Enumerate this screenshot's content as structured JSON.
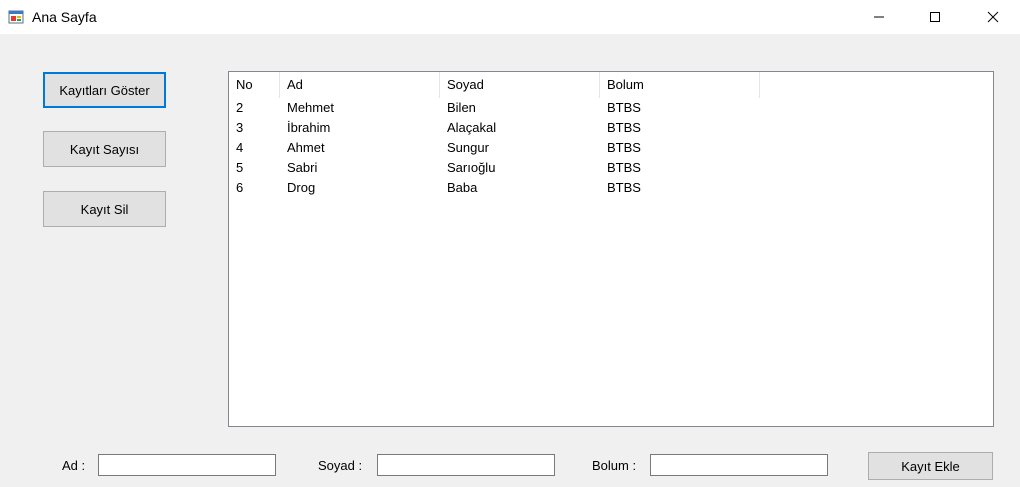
{
  "window": {
    "title": "Ana Sayfa",
    "app_icon": "form-app-icon",
    "controls": {
      "minimize": "minimize-icon",
      "maximize": "maximize-icon",
      "close": "close-icon"
    }
  },
  "sidebar": {
    "show_records": "Kayıtları Göster",
    "record_count": "Kayıt Sayısı",
    "delete_record": "Kayıt Sil"
  },
  "listview": {
    "columns": [
      "No",
      "Ad",
      "Soyad",
      "Bolum"
    ],
    "rows": [
      [
        "2",
        "Mehmet",
        "Bilen",
        "BTBS"
      ],
      [
        "3",
        "İbrahim",
        "Alaçakal",
        "BTBS"
      ],
      [
        "4",
        "Ahmet",
        "Sungur",
        "BTBS"
      ],
      [
        "5",
        "Sabri",
        "Sarıoğlu",
        "BTBS"
      ],
      [
        "6",
        "Drog",
        "Baba",
        "BTBS"
      ]
    ]
  },
  "form": {
    "ad_label": "Ad :",
    "ad_value": "",
    "soyad_label": "Soyad :",
    "soyad_value": "",
    "bolum_label": "Bolum :",
    "bolum_value": "",
    "add_button": "Kayıt Ekle"
  },
  "colors": {
    "focus_border": "#0078d7",
    "button_face": "#e1e1e1",
    "window_bg": "#f0f0f0"
  }
}
